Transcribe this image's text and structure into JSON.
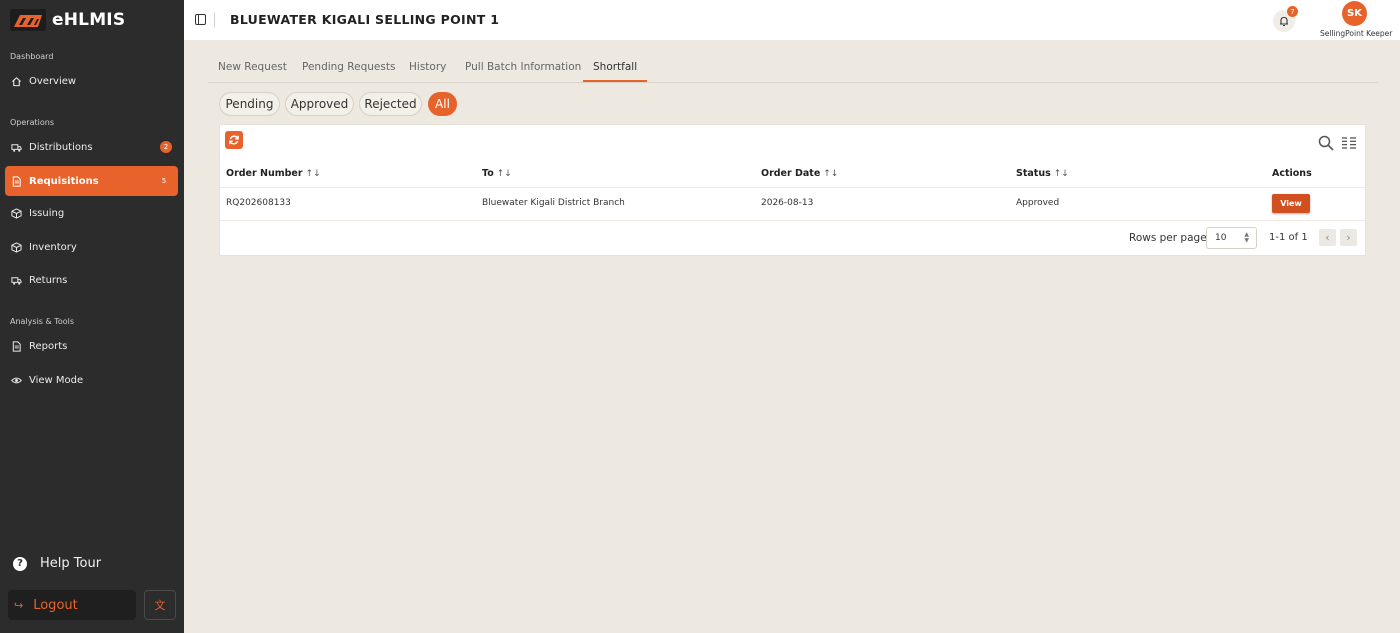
{
  "app": {
    "name": "eHLMIS"
  },
  "sidebar": {
    "sections": {
      "dashboard": "Dashboard",
      "operations": "Operations",
      "analysis": "Analysis & Tools"
    },
    "items": [
      {
        "label": "Overview",
        "icon": "home-icon"
      },
      {
        "label": "Distributions",
        "icon": "truck-icon",
        "badge": "2"
      },
      {
        "label": "Requisitions",
        "icon": "document-icon",
        "badge": "5",
        "active": true
      },
      {
        "label": "Issuing",
        "icon": "package-icon"
      },
      {
        "label": "Inventory",
        "icon": "box-icon"
      },
      {
        "label": "Returns",
        "icon": "truck-return-icon"
      },
      {
        "label": "Reports",
        "icon": "report-icon"
      },
      {
        "label": "View Mode",
        "icon": "eye-icon"
      }
    ],
    "help_tour": "Help Tour",
    "logout": "Logout"
  },
  "header": {
    "title": "BLUEWATER KIGALI SELLING POINT 1",
    "notification_count": "7",
    "avatar_initials": "SK",
    "user_role": "SellingPoint Keeper"
  },
  "tabs": [
    {
      "label": "New Request"
    },
    {
      "label": "Pending Requests"
    },
    {
      "label": "History"
    },
    {
      "label": "Pull Batch Information"
    },
    {
      "label": "Shortfall",
      "active": true
    }
  ],
  "filters": [
    {
      "label": "Pending"
    },
    {
      "label": "Approved"
    },
    {
      "label": "Rejected"
    },
    {
      "label": "All",
      "active": true
    }
  ],
  "table": {
    "columns": [
      {
        "label": "Order Number",
        "sort": "↑↓"
      },
      {
        "label": "To",
        "sort": "↑↓"
      },
      {
        "label": "Order Date",
        "sort": "↑↓"
      },
      {
        "label": "Status",
        "sort": "↑↓"
      },
      {
        "label": "Actions"
      }
    ],
    "rows": [
      {
        "order_number": "RQ202608133",
        "to": "Bluewater Kigali District Branch",
        "order_date": "2026-08-13",
        "status": "Approved",
        "action": "View"
      }
    ]
  },
  "pagination": {
    "rows_per_page_label": "Rows per page",
    "rows_per_page": "10",
    "range": "1-1 of 1"
  },
  "colors": {
    "accent": "#e8622c",
    "sidebar": "#2c2c2c",
    "background": "#ede9e1"
  }
}
